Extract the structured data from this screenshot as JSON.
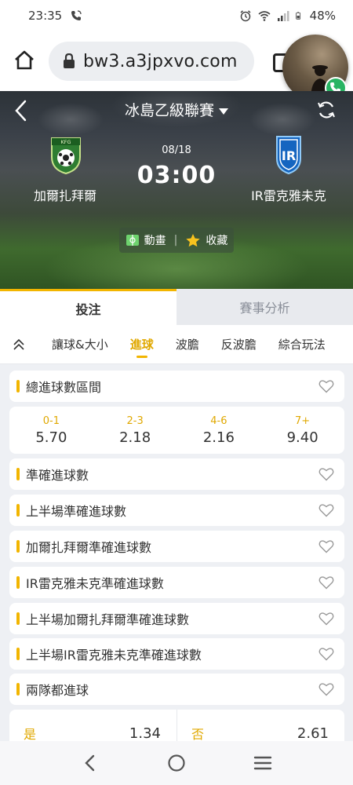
{
  "status_bar": {
    "time": "23:35",
    "battery": "48%"
  },
  "browser": {
    "url": "bw3.a3jpxvo.com"
  },
  "match": {
    "league": "冰島乙級聯賽",
    "date": "08/18",
    "time": "03:00",
    "home_team": "加爾扎拜爾",
    "away_team": "IR雷克雅未克",
    "home_logo_text": "KFG",
    "away_logo_text": "IR",
    "animation_label": "動畫",
    "favorite_label": "收藏"
  },
  "main_tabs": [
    {
      "label": "投注",
      "active": true
    },
    {
      "label": "賽事分析",
      "active": false
    }
  ],
  "sub_tabs": [
    {
      "label": "讓球&大小",
      "active": false
    },
    {
      "label": "進球",
      "active": true
    },
    {
      "label": "波膽",
      "active": false
    },
    {
      "label": "反波膽",
      "active": false
    },
    {
      "label": "綜合玩法",
      "active": false
    }
  ],
  "markets": {
    "total_goals_range": {
      "title": "總進球數區間",
      "options": [
        {
          "label": "0-1",
          "odds": "5.70"
        },
        {
          "label": "2-3",
          "odds": "2.18"
        },
        {
          "label": "4-6",
          "odds": "2.16"
        },
        {
          "label": "7+",
          "odds": "9.40"
        }
      ]
    },
    "exact_goals": {
      "title": "準確進球數"
    },
    "first_half_exact_goals": {
      "title": "上半場準確進球數"
    },
    "home_exact_goals": {
      "title": "加爾扎拜爾準確進球數"
    },
    "away_exact_goals": {
      "title": "IR雷克雅未克準確進球數"
    },
    "first_half_home_exact_goals": {
      "title": "上半場加爾扎拜爾準確進球數"
    },
    "first_half_away_exact_goals": {
      "title": "上半場IR雷克雅未克準確進球數"
    },
    "both_teams_score": {
      "title": "兩隊都進球",
      "options": [
        {
          "label": "是",
          "odds": "1.34"
        },
        {
          "label": "否",
          "odds": "2.61"
        }
      ]
    }
  },
  "colors": {
    "accent": "#f2b500",
    "accent_text": "#e0a800"
  }
}
